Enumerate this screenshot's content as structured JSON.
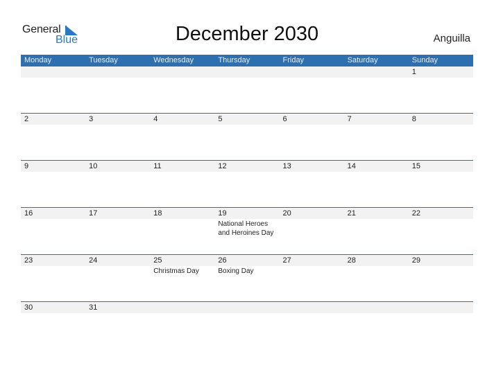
{
  "logo": {
    "general": "General",
    "blue": "Blue"
  },
  "title": "December 2030",
  "country": "Anguilla",
  "colors": {
    "accent": "#2e6fb0",
    "strip": "#f2f2f2",
    "logo_blue": "#2a78c2"
  },
  "weekdays": [
    "Monday",
    "Tuesday",
    "Wednesday",
    "Thursday",
    "Friday",
    "Saturday",
    "Sunday"
  ],
  "weeks": [
    [
      {
        "day": ""
      },
      {
        "day": ""
      },
      {
        "day": ""
      },
      {
        "day": ""
      },
      {
        "day": ""
      },
      {
        "day": ""
      },
      {
        "day": "1"
      }
    ],
    [
      {
        "day": "2"
      },
      {
        "day": "3"
      },
      {
        "day": "4"
      },
      {
        "day": "5"
      },
      {
        "day": "6"
      },
      {
        "day": "7"
      },
      {
        "day": "8"
      }
    ],
    [
      {
        "day": "9"
      },
      {
        "day": "10"
      },
      {
        "day": "11"
      },
      {
        "day": "12"
      },
      {
        "day": "13"
      },
      {
        "day": "14"
      },
      {
        "day": "15"
      }
    ],
    [
      {
        "day": "16"
      },
      {
        "day": "17"
      },
      {
        "day": "18"
      },
      {
        "day": "19",
        "holiday": "National Heroes\nand Heroines Day"
      },
      {
        "day": "20"
      },
      {
        "day": "21"
      },
      {
        "day": "22"
      }
    ],
    [
      {
        "day": "23"
      },
      {
        "day": "24"
      },
      {
        "day": "25",
        "holiday": "Christmas Day"
      },
      {
        "day": "26",
        "holiday": "Boxing Day"
      },
      {
        "day": "27"
      },
      {
        "day": "28"
      },
      {
        "day": "29"
      }
    ],
    [
      {
        "day": "30"
      },
      {
        "day": "31"
      },
      {
        "day": ""
      },
      {
        "day": ""
      },
      {
        "day": ""
      },
      {
        "day": ""
      },
      {
        "day": ""
      }
    ]
  ]
}
